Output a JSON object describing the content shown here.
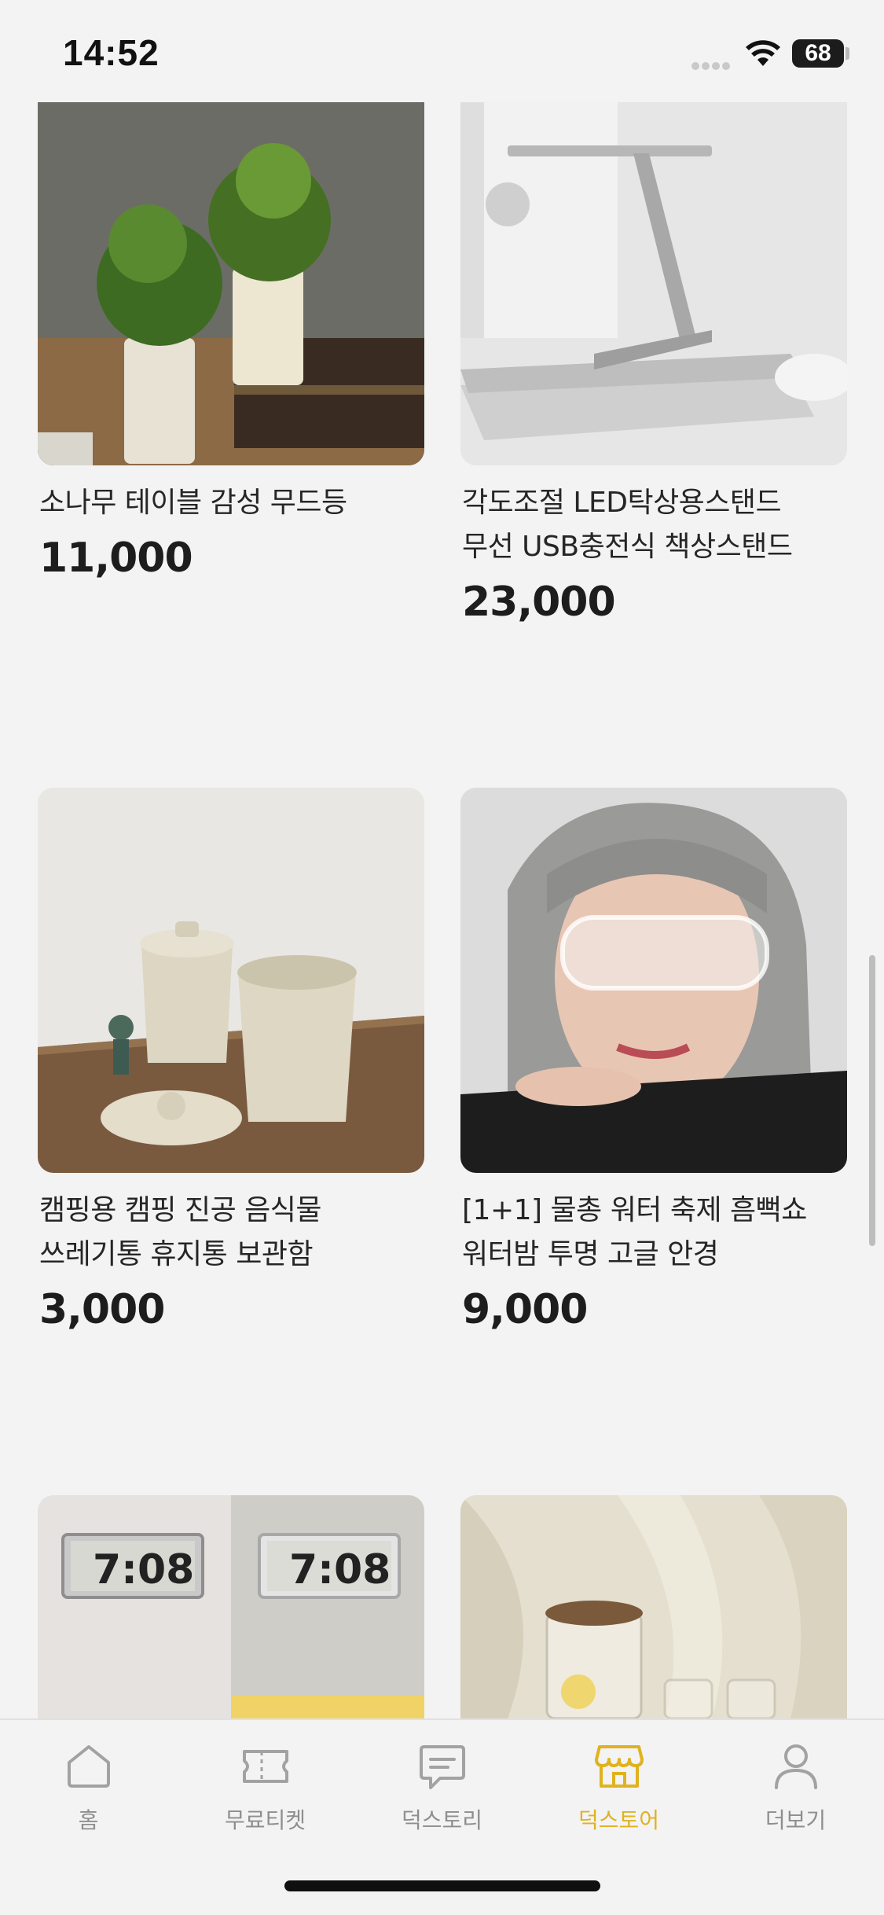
{
  "status_bar": {
    "time": "14:52",
    "battery": "68"
  },
  "products": [
    {
      "title_lines": [
        "소나무 테이블 감성 무드등"
      ],
      "price": "11,000"
    },
    {
      "title_lines": [
        "각도조절 LED탁상용스탠드",
        "무선 USB충전식 책상스탠드"
      ],
      "price": "23,000"
    },
    {
      "title_lines": [
        "캠핑용 캠핑 진공 음식물",
        "쓰레기통 휴지통 보관함"
      ],
      "price": "3,000"
    },
    {
      "title_lines": [
        "[1+1] 물총 워터 축제 흠뻑쇼",
        "워터밤 투명 고글 안경"
      ],
      "price": "9,000"
    }
  ],
  "partial_products": [
    {
      "image": "digital-clock-image"
    },
    {
      "image": "glass-pitcher-image"
    }
  ],
  "tab_bar": {
    "tabs": [
      {
        "label": "홈",
        "icon": "home-icon",
        "active": false
      },
      {
        "label": "무료티켓",
        "icon": "ticket-icon",
        "active": false
      },
      {
        "label": "덕스토리",
        "icon": "chat-bubble-icon",
        "active": false
      },
      {
        "label": "덕스토어",
        "icon": "store-icon",
        "active": true
      },
      {
        "label": "더보기",
        "icon": "person-icon",
        "active": false
      }
    ]
  },
  "colors": {
    "accent": "#e0b21f",
    "inactive": "#8e8e8e",
    "background": "#f3f3f3"
  }
}
